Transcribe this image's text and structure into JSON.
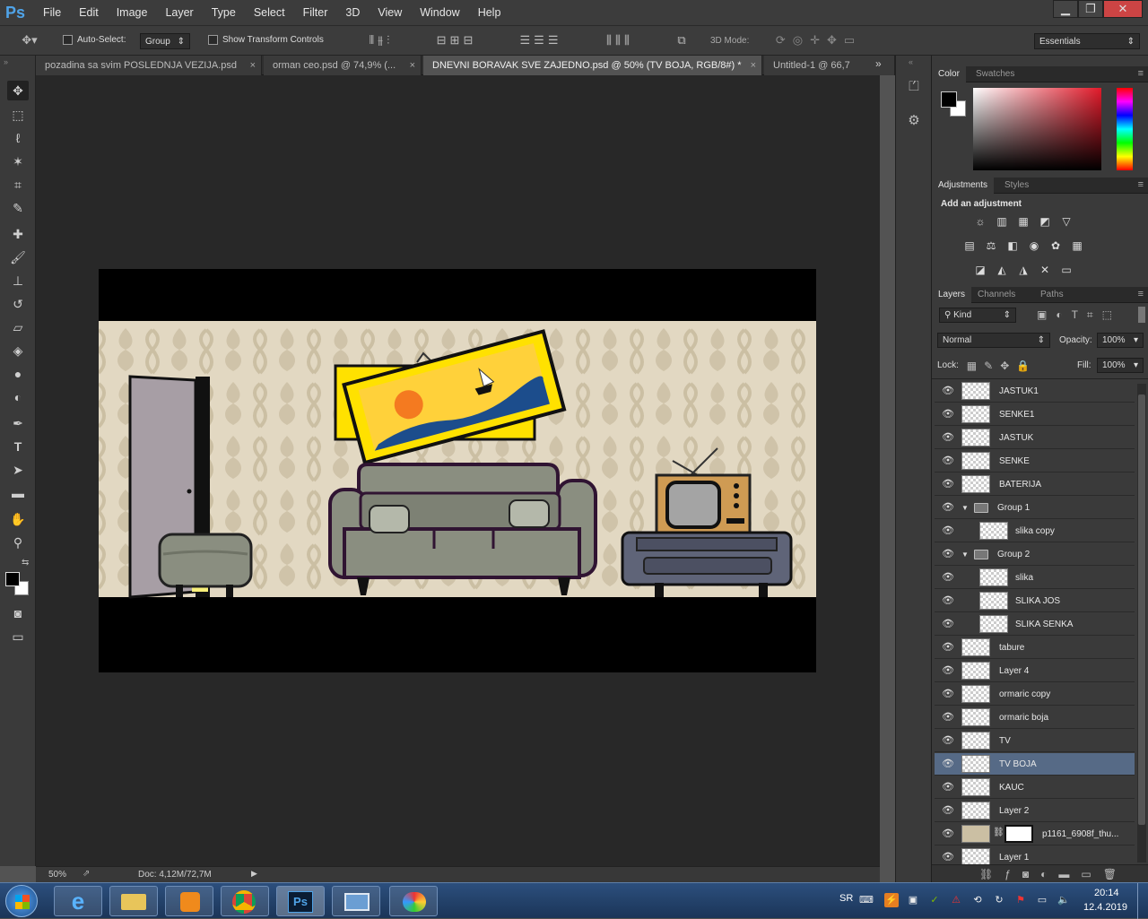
{
  "app": {
    "logo": "Ps"
  },
  "menu": [
    "File",
    "Edit",
    "Image",
    "Layer",
    "Type",
    "Select",
    "Filter",
    "3D",
    "View",
    "Window",
    "Help"
  ],
  "window_controls": {
    "minimize": "▁",
    "restore": "❐",
    "close": "✕"
  },
  "options": {
    "auto_select_label": "Auto-Select:",
    "auto_select_value": "Group",
    "transform_label": "Show Transform Controls",
    "mode_3d_label": "3D Mode:",
    "workspace": "Essentials"
  },
  "tabs": [
    {
      "label": "pozadina sa svim POSLEDNJA VEZIJA.psd",
      "close": "×",
      "active": false
    },
    {
      "label": "orman ceo.psd @ 74,9% (...",
      "close": "×",
      "active": false
    },
    {
      "label": "DNEVNI BORAVAK SVE ZAJEDNO.psd @ 50% (TV BOJA, RGB/8#) *",
      "close": "×",
      "active": true
    },
    {
      "label": "Untitled-1 @ 66,7",
      "close": "",
      "active": false
    }
  ],
  "tabs_overflow": "»",
  "status": {
    "zoom": "50%",
    "doc": "Doc: 4,12M/72,7M"
  },
  "color_panel": {
    "tabs": [
      "Color",
      "Swatches"
    ],
    "foreground": "#000000",
    "background": "#ffffff"
  },
  "adjustments_panel": {
    "tabs": [
      "Adjustments",
      "Styles"
    ],
    "heading": "Add an adjustment"
  },
  "layers_panel": {
    "tabs": [
      "Layers",
      "Channels",
      "Paths"
    ],
    "filter_kind": "Kind",
    "blend_mode": "Normal",
    "opacity_label": "Opacity:",
    "opacity_value": "100%",
    "lock_label": "Lock:",
    "fill_label": "Fill:",
    "fill_value": "100%",
    "layers": [
      {
        "name": "JASTUK1",
        "type": "layer",
        "indent": 0
      },
      {
        "name": "SENKE1",
        "type": "layer",
        "indent": 0
      },
      {
        "name": "JASTUK",
        "type": "layer",
        "indent": 0
      },
      {
        "name": "SENKE",
        "type": "layer",
        "indent": 0
      },
      {
        "name": "BATERIJA",
        "type": "layer",
        "indent": 0
      },
      {
        "name": "Group 1",
        "type": "group",
        "indent": 0
      },
      {
        "name": "slika copy",
        "type": "layer",
        "indent": 1
      },
      {
        "name": "Group 2",
        "type": "group",
        "indent": 0
      },
      {
        "name": "slika",
        "type": "layer",
        "indent": 1
      },
      {
        "name": "SLIKA JOS",
        "type": "layer",
        "indent": 1
      },
      {
        "name": "SLIKA SENKA",
        "type": "layer",
        "indent": 1
      },
      {
        "name": "tabure",
        "type": "layer",
        "indent": 0
      },
      {
        "name": "Layer 4",
        "type": "layer",
        "indent": 0
      },
      {
        "name": "ormaric copy",
        "type": "layer",
        "indent": 0
      },
      {
        "name": "ormaric boja",
        "type": "layer",
        "indent": 0
      },
      {
        "name": "TV",
        "type": "layer",
        "indent": 0
      },
      {
        "name": "TV BOJA",
        "type": "layer",
        "indent": 0,
        "selected": true
      },
      {
        "name": "KAUC",
        "type": "layer",
        "indent": 0
      },
      {
        "name": "Layer 2",
        "type": "layer",
        "indent": 0
      },
      {
        "name": "p1161_6908f_thu...",
        "type": "masked",
        "indent": 0
      },
      {
        "name": "Layer 1",
        "type": "layer",
        "indent": 0
      }
    ]
  },
  "taskbar": {
    "lang": "SR",
    "time": "20:14",
    "date": "12.4.2019",
    "ps_label": "Ps"
  }
}
